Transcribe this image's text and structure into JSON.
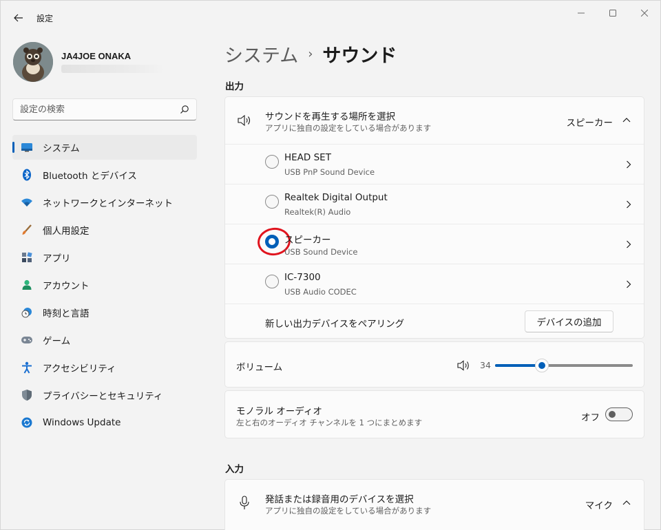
{
  "window": {
    "app_title": "設定",
    "back_icon": "arrow-left-icon",
    "controls": [
      "minimize-icon",
      "maximize-icon",
      "close-icon"
    ]
  },
  "profile": {
    "name": "JA4JOE ONAKA"
  },
  "search": {
    "placeholder": "設定の検索",
    "icon": "search-icon"
  },
  "sidebar": {
    "items": [
      {
        "label": "システム",
        "icon": "system-monitor-icon",
        "active": true
      },
      {
        "label": "Bluetooth とデバイス",
        "icon": "bluetooth-icon"
      },
      {
        "label": "ネットワークとインターネット",
        "icon": "wifi-icon"
      },
      {
        "label": "個人用設定",
        "icon": "paintbrush-icon"
      },
      {
        "label": "アプリ",
        "icon": "apps-icon"
      },
      {
        "label": "アカウント",
        "icon": "person-icon"
      },
      {
        "label": "時刻と言語",
        "icon": "clock-globe-icon"
      },
      {
        "label": "ゲーム",
        "icon": "gamepad-icon"
      },
      {
        "label": "アクセシビリティ",
        "icon": "accessibility-icon"
      },
      {
        "label": "プライバシーとセキュリティ",
        "icon": "shield-icon"
      },
      {
        "label": "Windows Update",
        "icon": "windows-update-icon"
      }
    ]
  },
  "breadcrumb": {
    "parent": "システム",
    "separator": "›",
    "current": "サウンド"
  },
  "output": {
    "section_label": "出力",
    "selector": {
      "title": "サウンドを再生する場所を選択",
      "subtitle": "アプリに独自の設定をしている場合があります",
      "value": "スピーカー"
    },
    "devices": [
      {
        "name": "HEAD SET",
        "desc": "USB PnP Sound Device",
        "selected": false
      },
      {
        "name": "Realtek Digital Output",
        "desc": "Realtek(R) Audio",
        "selected": false
      },
      {
        "name": "スピーカー",
        "desc": "USB Sound Device",
        "selected": true
      },
      {
        "name": "IC-7300",
        "desc": "USB Audio CODEC",
        "selected": false
      }
    ],
    "pair": {
      "label": "新しい出力デバイスをペアリング",
      "button": "デバイスの追加"
    },
    "volume": {
      "label": "ボリューム",
      "value": "34",
      "level": 34
    },
    "mono": {
      "title": "モノラル オーディオ",
      "subtitle": "左と右のオーディオ チャンネルを 1 つにまとめます",
      "state": "オフ"
    }
  },
  "input": {
    "section_label": "入力",
    "selector": {
      "title": "発話または録音用のデバイスを選択",
      "subtitle": "アプリに独自の設定をしている場合があります",
      "value": "マイク"
    }
  },
  "colors": {
    "accent": "#005fb8",
    "annotation": "#e0141e"
  }
}
